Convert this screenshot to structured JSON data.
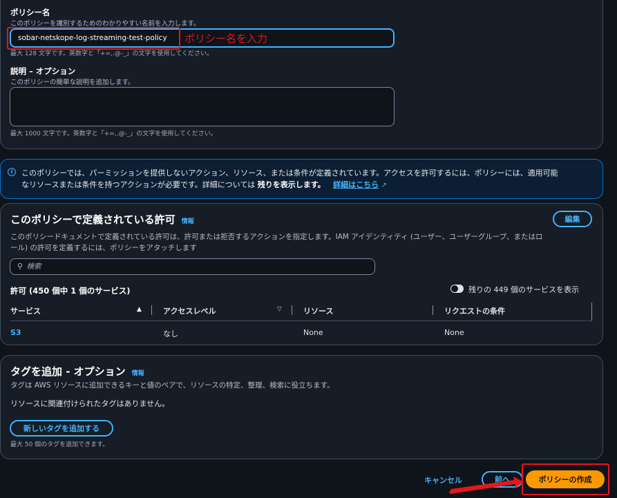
{
  "policy_details": {
    "name_label": "ポリシー名",
    "name_desc": "このポリシーを識別するためのわかりやすい名前を入力します。",
    "name_value": "sobar-netskope-log-streaming-test-policy",
    "name_hint": "最大 128 文字です。英数字と「+=,.@-_」の文字を使用してください。",
    "annotation_text": "ポリシー名を入力",
    "desc_label": "説明 – オプション",
    "desc_desc": "このポリシーの簡単な説明を追加します。",
    "desc_hint": "最大 1000 文字です。英数字と「+=,.@-_」の文字を使用してください。"
  },
  "info_alert": {
    "line1": "このポリシーでは、パーミッションを提供しないアクション、リソース、または条件が定義されています。アクセスを許可するには、ポリシーには、適用可能",
    "line2": "なリソースまたは条件を持つアクションが必要です。詳細については ",
    "bold": "残りを表示します。",
    "link": "詳細はこちら"
  },
  "permissions": {
    "title": "このポリシーで定義されている許可",
    "info": "情報",
    "edit_button": "編集",
    "desc_line1": "このポリシードキュメントで定義されている許可は、許可または拒否するアクションを指定します。IAM アイデンティティ (ユーザー、ユーザーグループ、またはロ",
    "desc_line2": "ール) の許可を定義するには、ポリシーをアタッチします",
    "search_placeholder": "検索",
    "count_label": "許可 (450 個中 1 個のサービス)",
    "toggle_label": "残りの 449 個のサービスを表示",
    "columns": [
      "サービス",
      "アクセスレベル",
      "リソース",
      "リクエストの条件"
    ],
    "rows": [
      {
        "service": "S3",
        "access": "なし",
        "resource": "None",
        "condition": "None"
      }
    ]
  },
  "tags": {
    "title": "タグを追加 - オプション",
    "info": "情報",
    "desc": "タグは AWS リソースに追加できるキーと値のペアで、リソースの特定、整理、検索に役立ちます。",
    "empty": "リソースに関連付けられたタグはありません。",
    "add_button": "新しいタグを追加する",
    "hint": "最大 50 個のタグを追加できます。"
  },
  "footer": {
    "cancel": "キャンセル",
    "previous": "前へ",
    "create": "ポリシーの作成"
  },
  "colors": {
    "accent": "#42b4ff",
    "primary_button": "#ff9900",
    "annotation": "#e3171c"
  }
}
